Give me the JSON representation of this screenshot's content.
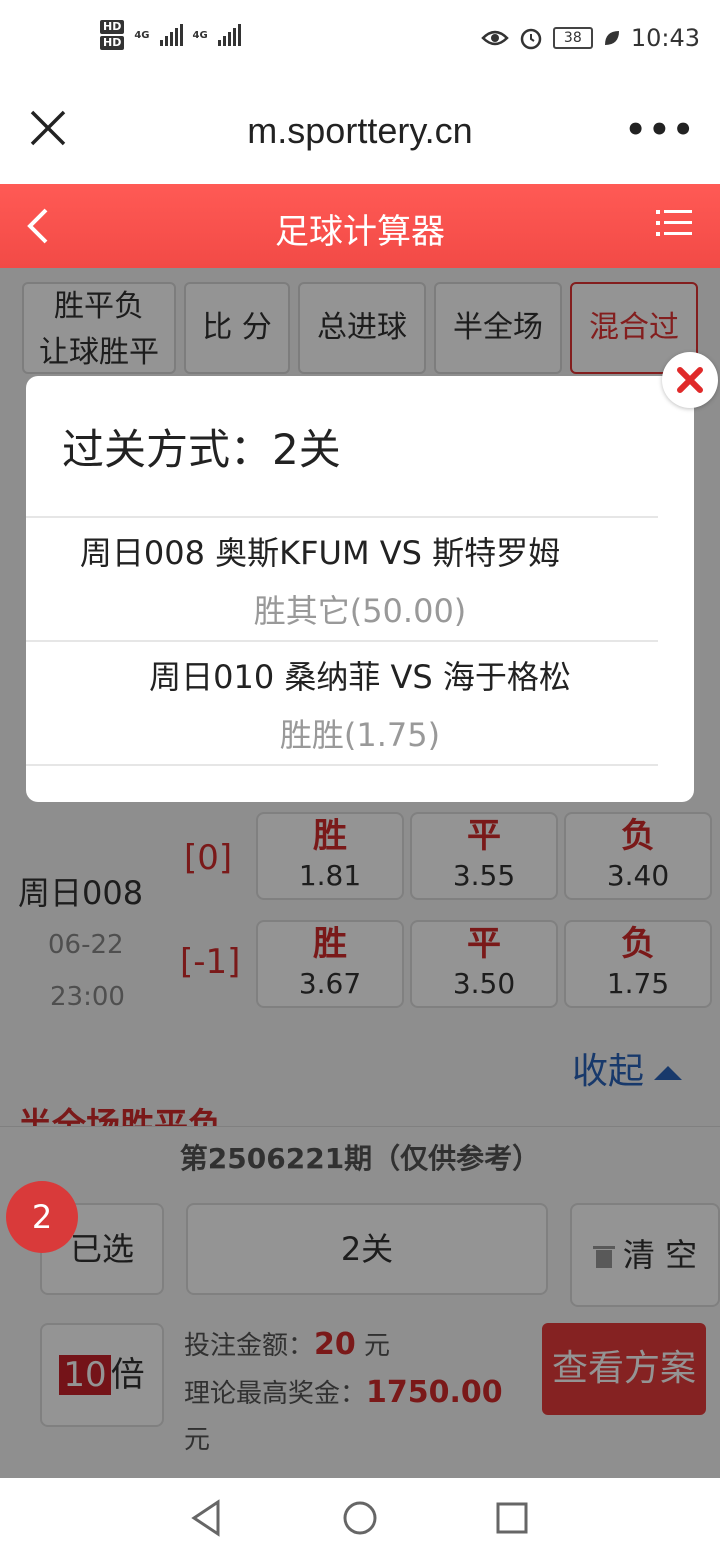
{
  "status_bar": {
    "time": "10:43",
    "battery": "38",
    "network_1": "4G",
    "network_2": "4G",
    "hd": "HD"
  },
  "browser": {
    "url": "m.sporttery.cn"
  },
  "header": {
    "title": "足球计算器"
  },
  "tabs": [
    {
      "line1": "胜平负",
      "line2": "让球胜平"
    },
    {
      "label": "比 分"
    },
    {
      "label": "总进球"
    },
    {
      "label": "半全场"
    },
    {
      "label": "混合过"
    }
  ],
  "match": {
    "number": "周日008",
    "date": "06-22",
    "time": "23:00",
    "rows": [
      {
        "handicap": "[0]",
        "odds": [
          {
            "result": "胜",
            "value": "1.81"
          },
          {
            "result": "平",
            "value": "3.55"
          },
          {
            "result": "负",
            "value": "3.40"
          }
        ]
      },
      {
        "handicap": "[-1]",
        "odds": [
          {
            "result": "胜",
            "value": "3.67"
          },
          {
            "result": "平",
            "value": "3.50"
          },
          {
            "result": "负",
            "value": "1.75"
          }
        ]
      }
    ],
    "collapse_label": "收起"
  },
  "section_title": "半全场胜平负",
  "bottom": {
    "issue": "第2506221期（仅供参考）",
    "selected_count": "2",
    "selected_label": "已选",
    "pass_label": "2关",
    "clear_label": "清 空",
    "multiplier_num": "10",
    "multiplier_unit": "倍",
    "bet_label": "投注金额：",
    "bet_amount": "20",
    "bet_unit": "元",
    "prize_label": "理论最高奖金：",
    "prize_amount": "1750.00",
    "prize_unit": "元",
    "view_plan": "查看方案"
  },
  "modal": {
    "title": "过关方式：2关",
    "items": [
      {
        "match": "周日008   奥斯KFUM VS 斯特罗姆",
        "pick": "胜其它(50.00)"
      },
      {
        "match": "周日010   桑纳菲 VS 海于格松",
        "pick": "胜胜(1.75)"
      }
    ]
  },
  "colors": {
    "brand_red": "#f24a46",
    "odd_red": "#d32b2b",
    "link_blue": "#2a63b8"
  }
}
